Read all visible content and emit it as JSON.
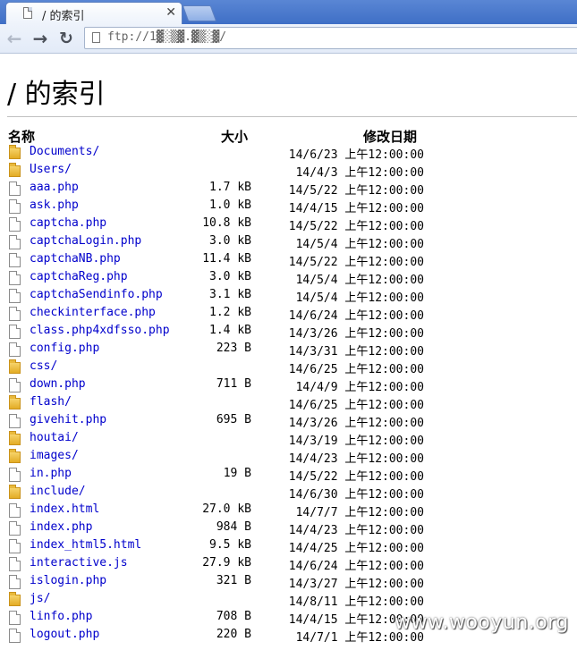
{
  "browser": {
    "tab_title": "/ 的索引",
    "close_glyph": "✕",
    "url": "ftp://1▓░▒▓.▓▒░▓/",
    "back_glyph": "←",
    "forward_glyph": "→",
    "reload_glyph": "↻"
  },
  "page": {
    "heading": "/ 的索引",
    "columns": {
      "name": "名称",
      "size": "大小",
      "date": "修改日期"
    }
  },
  "entries": [
    {
      "name": "Documents/",
      "size": "",
      "date": "14/6/23 上午12:00:00",
      "icon": "folder-icon"
    },
    {
      "name": "Users/",
      "size": "",
      "date": "14/4/3 上午12:00:00",
      "icon": "folder-icon"
    },
    {
      "name": "aaa.php",
      "size": "1.7 kB",
      "date": "14/5/22 上午12:00:00",
      "icon": "file-icon"
    },
    {
      "name": "ask.php",
      "size": "1.0 kB",
      "date": "14/4/15 上午12:00:00",
      "icon": "file-icon"
    },
    {
      "name": "captcha.php",
      "size": "10.8 kB",
      "date": "14/5/22 上午12:00:00",
      "icon": "file-icon"
    },
    {
      "name": "captchaLogin.php",
      "size": "3.0 kB",
      "date": "14/5/4 上午12:00:00",
      "icon": "file-icon"
    },
    {
      "name": "captchaNB.php",
      "size": "11.4 kB",
      "date": "14/5/22 上午12:00:00",
      "icon": "file-icon"
    },
    {
      "name": "captchaReg.php",
      "size": "3.0 kB",
      "date": "14/5/4 上午12:00:00",
      "icon": "file-icon"
    },
    {
      "name": "captchaSendinfo.php",
      "size": "3.1 kB",
      "date": "14/5/4 上午12:00:00",
      "icon": "file-icon"
    },
    {
      "name": "checkinterface.php",
      "size": "1.2 kB",
      "date": "14/6/24 上午12:00:00",
      "icon": "file-icon"
    },
    {
      "name": "class.php4xdfsso.php",
      "size": "1.4 kB",
      "date": "14/3/26 上午12:00:00",
      "icon": "file-icon"
    },
    {
      "name": "config.php",
      "size": "223 B",
      "date": "14/3/31 上午12:00:00",
      "icon": "file-icon"
    },
    {
      "name": "css/",
      "size": "",
      "date": "14/6/25 上午12:00:00",
      "icon": "folder-icon"
    },
    {
      "name": "down.php",
      "size": "711 B",
      "date": "14/4/9 上午12:00:00",
      "icon": "file-icon"
    },
    {
      "name": "flash/",
      "size": "",
      "date": "14/6/25 上午12:00:00",
      "icon": "folder-icon"
    },
    {
      "name": "givehit.php",
      "size": "695 B",
      "date": "14/3/26 上午12:00:00",
      "icon": "file-icon"
    },
    {
      "name": "houtai/",
      "size": "",
      "date": "14/3/19 上午12:00:00",
      "icon": "folder-icon"
    },
    {
      "name": "images/",
      "size": "",
      "date": "14/4/23 上午12:00:00",
      "icon": "folder-icon"
    },
    {
      "name": "in.php",
      "size": "19 B",
      "date": "14/5/22 上午12:00:00",
      "icon": "file-icon"
    },
    {
      "name": "include/",
      "size": "",
      "date": "14/6/30 上午12:00:00",
      "icon": "folder-icon"
    },
    {
      "name": "index.html",
      "size": "27.0 kB",
      "date": "14/7/7 上午12:00:00",
      "icon": "file-icon"
    },
    {
      "name": "index.php",
      "size": "984 B",
      "date": "14/4/23 上午12:00:00",
      "icon": "file-icon"
    },
    {
      "name": "index_html5.html",
      "size": "9.5 kB",
      "date": "14/4/25 上午12:00:00",
      "icon": "file-icon"
    },
    {
      "name": "interactive.js",
      "size": "27.9 kB",
      "date": "14/6/24 上午12:00:00",
      "icon": "file-icon"
    },
    {
      "name": "islogin.php",
      "size": "321 B",
      "date": "14/3/27 上午12:00:00",
      "icon": "file-icon"
    },
    {
      "name": "js/",
      "size": "",
      "date": "14/8/11 上午12:00:00",
      "icon": "folder-icon"
    },
    {
      "name": "linfo.php",
      "size": "708 B",
      "date": "14/4/15 上午12:00:00",
      "icon": "file-icon"
    },
    {
      "name": "logout.php",
      "size": "220 B",
      "date": "14/7/1 上午12:00:00",
      "icon": "file-icon"
    }
  ],
  "watermark": "www.wooyun.org"
}
